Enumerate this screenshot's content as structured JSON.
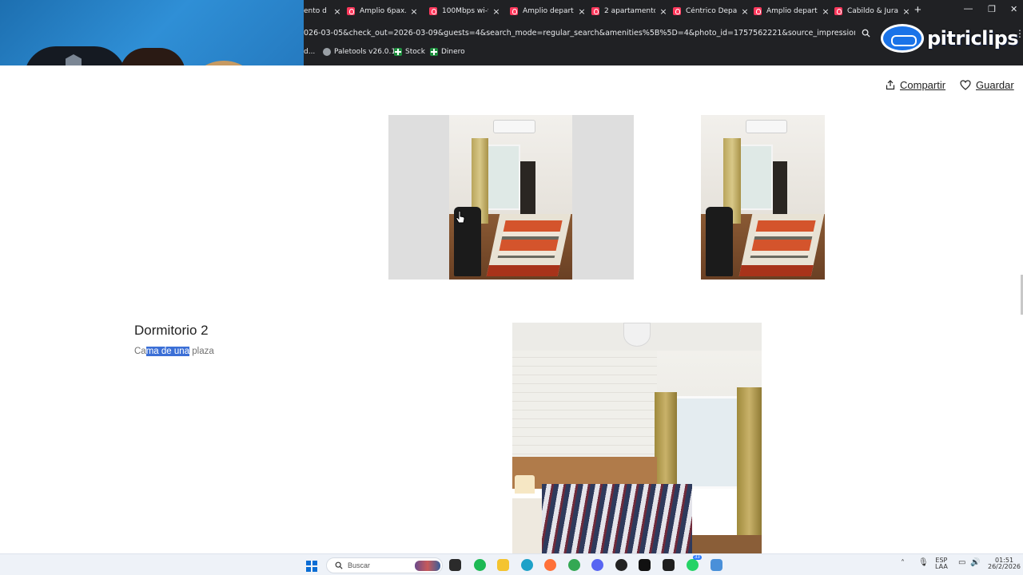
{
  "browser": {
    "tabs": [
      {
        "title": "ento d"
      },
      {
        "title": "Amplio 6pax."
      },
      {
        "title": "100Mbps wi-fi"
      },
      {
        "title": "Amplio depart"
      },
      {
        "title": "2 apartamento"
      },
      {
        "title": "Céntrico Depa"
      },
      {
        "title": "Amplio depart"
      },
      {
        "title": "Cabildo & Jura"
      }
    ],
    "url": "026-03-05&check_out=2026-03-09&guests=4&search_mode=regular_search&amenities%5B%5D=4&photo_id=1757562221&source_impression_id=p3_177208142...",
    "bookmarks": [
      {
        "label": "d...",
        "icon": "folder-icon"
      },
      {
        "label": "Paletools v26.0.12",
        "icon": "globe-icon"
      },
      {
        "label": "Stock",
        "icon": "sheets-icon"
      },
      {
        "label": "Dinero",
        "icon": "sheets-icon"
      }
    ]
  },
  "watermark": {
    "text": "pitriclips"
  },
  "listing": {
    "share_label": "Compartir",
    "save_label": "Guardar",
    "room": {
      "title": "Dormitorio 2",
      "desc_before": "Ca",
      "desc_selected": "ma de una",
      "desc_after": " plaza"
    }
  },
  "taskbar": {
    "search_placeholder": "Buscar",
    "apps": [
      "file-explorer-icon",
      "spotify-icon",
      "folder-icon",
      "edge-icon",
      "firefox-icon",
      "chrome-icon",
      "discord-icon",
      "obs-icon",
      "tiktok-icon",
      "capcut-icon",
      "whatsapp-icon",
      "notepad-icon"
    ],
    "whatsapp_badge": "33",
    "lang_top": "ESP",
    "lang_bottom": "LAA",
    "time": "01:51",
    "date": "26/2/2026"
  },
  "colors": {
    "airbnb": "#ff385c",
    "selection": "#3b6fd6",
    "chrome_bg": "#202124",
    "text_primary": "#222222",
    "text_secondary": "#717171"
  }
}
